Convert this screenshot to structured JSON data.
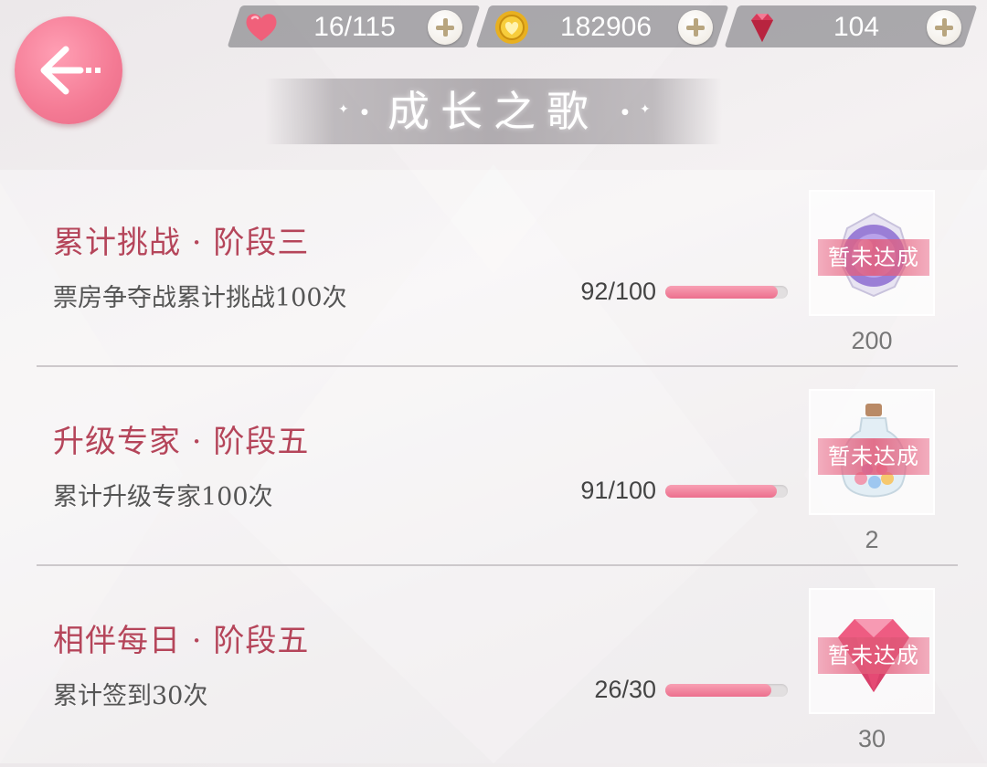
{
  "header": {
    "title": "成长之歌",
    "resources": [
      {
        "icon": "heart-icon",
        "value": "16/115",
        "color": "#f0607a"
      },
      {
        "icon": "gold-coin-icon",
        "value": "182906",
        "color": "#e8b020"
      },
      {
        "icon": "red-gem-icon",
        "value": "104",
        "color": "#d83a5a"
      }
    ]
  },
  "quests": [
    {
      "title": "累计挑战 · 阶段三",
      "description": "票房争夺战累计挑战100次",
      "progress_text": "92/100",
      "progress": 0.92,
      "reward_icon": "purple-orb-icon",
      "reward_status": "暂未达成",
      "reward_count": "200"
    },
    {
      "title": "升级专家 · 阶段五",
      "description": "累计升级专家100次",
      "progress_text": "91/100",
      "progress": 0.91,
      "reward_icon": "candy-jar-icon",
      "reward_status": "暂未达成",
      "reward_count": "2"
    },
    {
      "title": "相伴每日 · 阶段五",
      "description": "累计签到30次",
      "progress_text": "26/30",
      "progress": 0.867,
      "reward_icon": "pink-diamond-icon",
      "reward_status": "暂未达成",
      "reward_count": "30"
    }
  ],
  "colors": {
    "accent": "#f47a94",
    "title_red": "#b5455a",
    "progress_pink": "#ec6f8d"
  }
}
